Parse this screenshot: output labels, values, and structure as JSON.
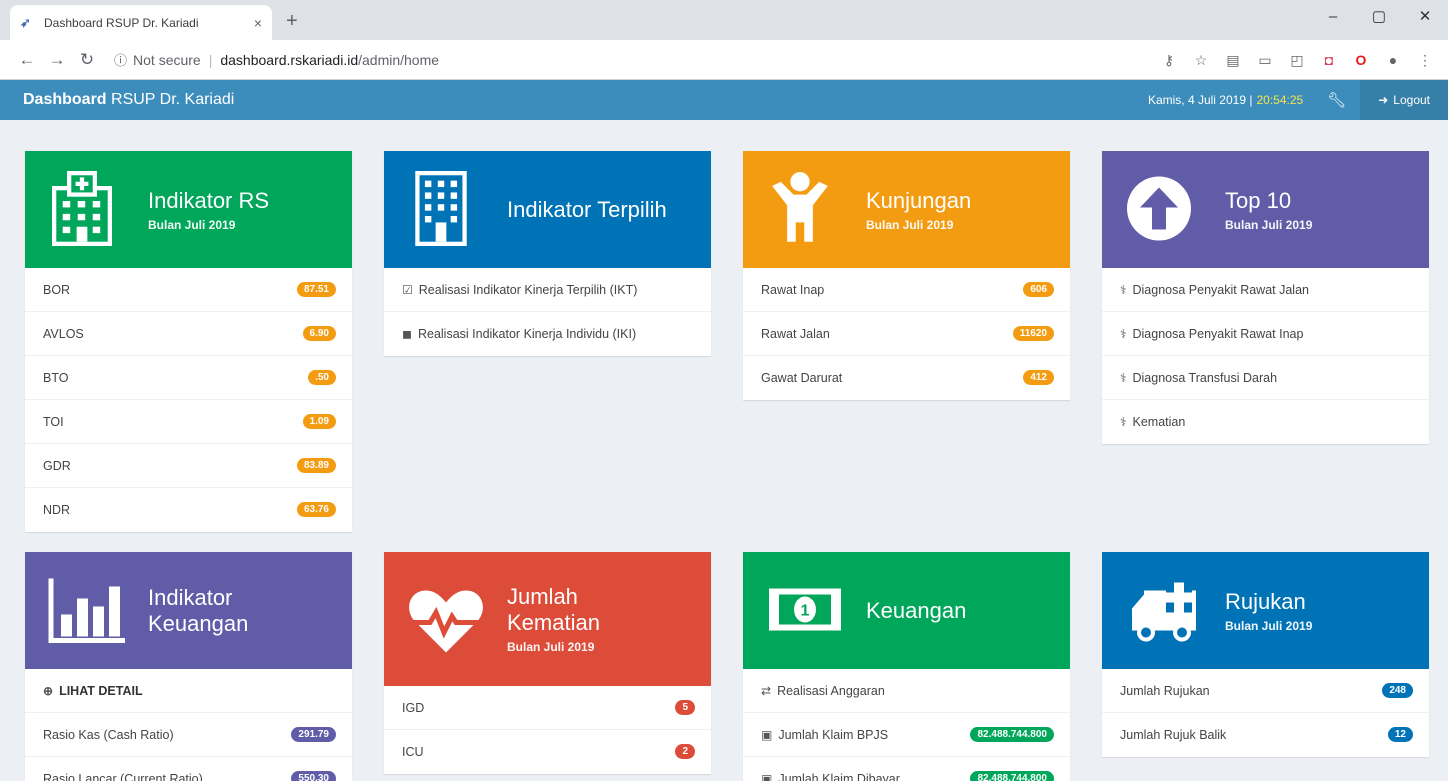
{
  "browser": {
    "tab_title": "Dashboard RSUP Dr. Kariadi",
    "tab_close": "×",
    "new_tab": "+",
    "security": "Not secure",
    "url_domain": "dashboard.rskariadi.id",
    "url_path": "/admin/home"
  },
  "header": {
    "brand_bold": "Dashboard",
    "brand_rest": " RSUP Dr. Kariadi",
    "date": "Kamis, 4 Juli 2019 |",
    "time": "20:54:25",
    "logout": "Logout"
  },
  "cards": {
    "indikator_rs": {
      "title": "Indikator RS",
      "sub": "Bulan Juli 2019",
      "items": [
        {
          "label": "BOR",
          "value": "87.51"
        },
        {
          "label": "AVLOS",
          "value": "6.90"
        },
        {
          "label": "BTO",
          "value": ".50"
        },
        {
          "label": "TOI",
          "value": "1.09"
        },
        {
          "label": "GDR",
          "value": "83.89"
        },
        {
          "label": "NDR",
          "value": "63.76"
        }
      ]
    },
    "indikator_terpilih": {
      "title": "Indikator Terpilih",
      "items": [
        {
          "label": "Realisasi Indikator Kinerja Terpilih (IKT)"
        },
        {
          "label": "Realisasi Indikator Kinerja Individu (IKI)"
        }
      ]
    },
    "kunjungan": {
      "title": "Kunjungan",
      "sub": "Bulan Juli 2019",
      "items": [
        {
          "label": "Rawat Inap",
          "value": "606"
        },
        {
          "label": "Rawat Jalan",
          "value": "11620"
        },
        {
          "label": "Gawat Darurat",
          "value": "412"
        }
      ]
    },
    "top10": {
      "title": "Top 10",
      "sub": "Bulan Juli 2019",
      "items": [
        {
          "label": "Diagnosa Penyakit Rawat Jalan"
        },
        {
          "label": "Diagnosa Penyakit Rawat Inap"
        },
        {
          "label": "Diagnosa Transfusi Darah"
        },
        {
          "label": "Kematian"
        }
      ]
    },
    "indikator_keuangan": {
      "title1": "Indikator",
      "title2": "Keuangan",
      "lihat": "LIHAT DETAIL",
      "items": [
        {
          "label": "Rasio Kas (Cash Ratio)",
          "value": "291.79"
        },
        {
          "label": "Rasio Lancar (Current Ratio)",
          "value": "550.30"
        }
      ]
    },
    "jumlah_kematian": {
      "title1": "Jumlah",
      "title2": "Kematian",
      "sub": "Bulan Juli 2019",
      "items": [
        {
          "label": "IGD",
          "value": "5"
        },
        {
          "label": "ICU",
          "value": "2"
        }
      ]
    },
    "keuangan": {
      "title": "Keuangan",
      "items": [
        {
          "label": "Realisasi Anggaran"
        },
        {
          "label": "Jumlah Klaim BPJS",
          "value": "82.488.744.800"
        },
        {
          "label": "Jumlah Klaim Dibayar",
          "value": "82.488.744.800"
        }
      ]
    },
    "rujukan": {
      "title": "Rujukan",
      "sub": "Bulan Juli 2019",
      "items": [
        {
          "label": "Jumlah Rujukan",
          "value": "248"
        },
        {
          "label": "Jumlah Rujuk Balik",
          "value": "12"
        }
      ]
    }
  },
  "colors": {
    "green": "#00a65a",
    "blue": "#0073b7",
    "orange": "#f39c12",
    "purple": "#605ca8",
    "red": "#dd4b39",
    "header": "#3c8dbc"
  }
}
